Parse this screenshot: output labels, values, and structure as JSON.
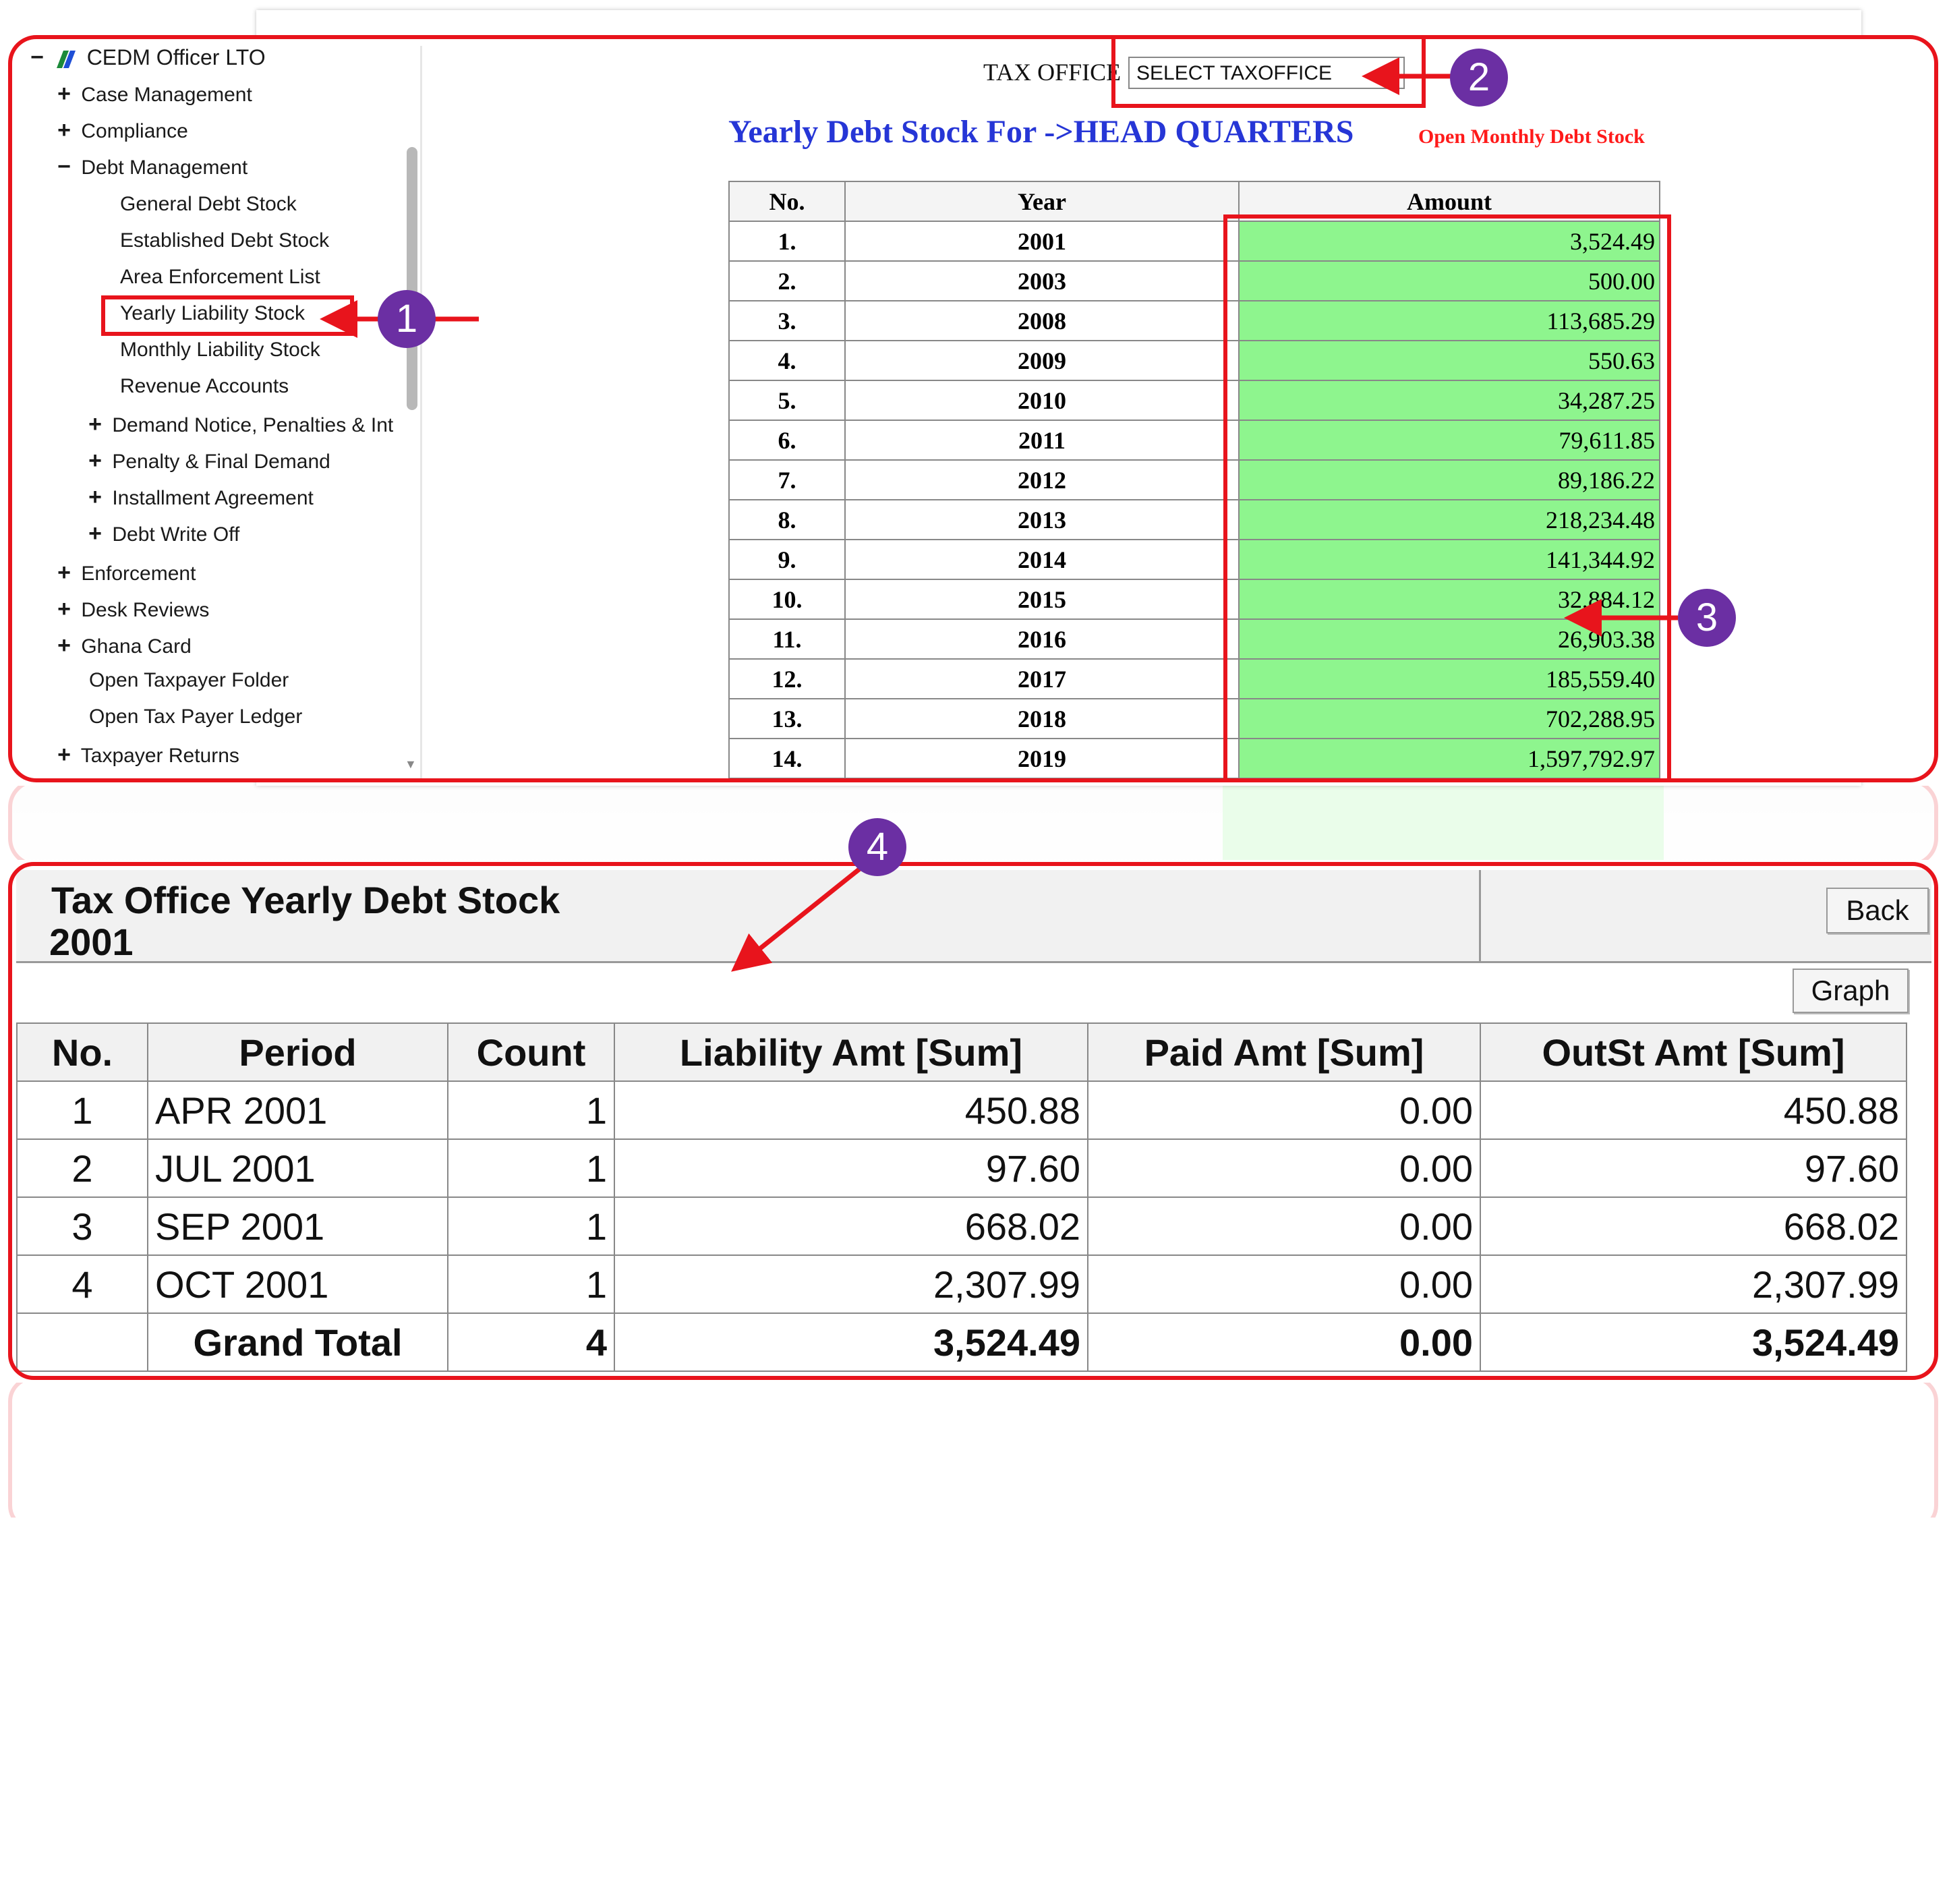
{
  "sidebar": {
    "root": "CEDM Officer LTO",
    "items": [
      {
        "sign": "+",
        "label": "Case Management"
      },
      {
        "sign": "+",
        "label": "Compliance"
      },
      {
        "sign": "−",
        "label": "Debt Management"
      },
      {
        "sign": "",
        "label": "General Debt Stock"
      },
      {
        "sign": "",
        "label": "Established Debt Stock"
      },
      {
        "sign": "",
        "label": "Area Enforcement List"
      },
      {
        "sign": "",
        "label": "Yearly Liability Stock"
      },
      {
        "sign": "",
        "label": "Monthly Liability Stock"
      },
      {
        "sign": "",
        "label": "Revenue Accounts"
      },
      {
        "sign": "+",
        "label": "Demand Notice, Penalties & Int"
      },
      {
        "sign": "+",
        "label": "Penalty & Final Demand"
      },
      {
        "sign": "+",
        "label": "Installment Agreement"
      },
      {
        "sign": "+",
        "label": "Debt Write Off"
      },
      {
        "sign": "+",
        "label": "Enforcement"
      },
      {
        "sign": "+",
        "label": "Desk Reviews"
      },
      {
        "sign": "+",
        "label": "Ghana Card"
      },
      {
        "sign": "",
        "label": "Open Taxpayer Folder"
      },
      {
        "sign": "",
        "label": "Open Tax Payer Ledger"
      },
      {
        "sign": "+",
        "label": "Taxpayer Returns"
      }
    ]
  },
  "tax_office": {
    "label": "TAX OFFICE",
    "selected": "SELECT TAXOFFICE"
  },
  "yearly": {
    "title": "Yearly Debt Stock For ->HEAD QUARTERS",
    "open_monthly": "Open Monthly Debt Stock",
    "headers": [
      "No.",
      "Year",
      "Amount"
    ],
    "rows": [
      {
        "no": "1.",
        "year": "2001",
        "amount": "3,524.49"
      },
      {
        "no": "2.",
        "year": "2003",
        "amount": "500.00"
      },
      {
        "no": "3.",
        "year": "2008",
        "amount": "113,685.29"
      },
      {
        "no": "4.",
        "year": "2009",
        "amount": "550.63"
      },
      {
        "no": "5.",
        "year": "2010",
        "amount": "34,287.25"
      },
      {
        "no": "6.",
        "year": "2011",
        "amount": "79,611.85"
      },
      {
        "no": "7.",
        "year": "2012",
        "amount": "89,186.22"
      },
      {
        "no": "8.",
        "year": "2013",
        "amount": "218,234.48"
      },
      {
        "no": "9.",
        "year": "2014",
        "amount": "141,344.92"
      },
      {
        "no": "10.",
        "year": "2015",
        "amount": "32,884.12"
      },
      {
        "no": "11.",
        "year": "2016",
        "amount": "26,903.38"
      },
      {
        "no": "12.",
        "year": "2017",
        "amount": "185,559.40"
      },
      {
        "no": "13.",
        "year": "2018",
        "amount": "702,288.95"
      },
      {
        "no": "14.",
        "year": "2019",
        "amount": "1,597,792.97"
      }
    ]
  },
  "detail": {
    "title": "Tax Office Yearly Debt Stock",
    "year": "2001",
    "back_label": "Back",
    "graph_label": "Graph",
    "headers": [
      "No.",
      "Period",
      "Count",
      "Liability Amt [Sum]",
      "Paid Amt [Sum]",
      "OutSt Amt [Sum]"
    ],
    "rows": [
      {
        "no": "1",
        "period": "APR 2001",
        "count": "1",
        "liability": "450.88",
        "paid": "0.00",
        "outst": "450.88"
      },
      {
        "no": "2",
        "period": "JUL 2001",
        "count": "1",
        "liability": "97.60",
        "paid": "0.00",
        "outst": "97.60"
      },
      {
        "no": "3",
        "period": "SEP 2001",
        "count": "1",
        "liability": "668.02",
        "paid": "0.00",
        "outst": "668.02"
      },
      {
        "no": "4",
        "period": "OCT 2001",
        "count": "1",
        "liability": "2,307.99",
        "paid": "0.00",
        "outst": "2,307.99"
      }
    ],
    "total": {
      "label": "Grand Total",
      "count": "4",
      "liability": "3,524.49",
      "paid": "0.00",
      "outst": "3,524.49"
    }
  },
  "callouts": [
    "1",
    "2",
    "3",
    "4"
  ],
  "colors": {
    "highlight": "#e8141c",
    "badge": "#6b2fa3",
    "title_blue": "#2636d6",
    "amount_green": "#8ef58e",
    "link_red": "#ff1a1a"
  }
}
